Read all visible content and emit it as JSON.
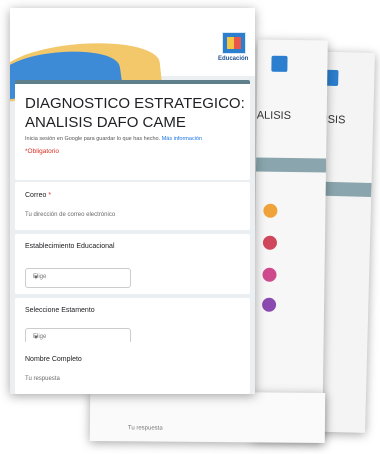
{
  "background_pages": {
    "title_peek": "ALISIS",
    "title_peek_far": "NALISIS",
    "peek_bottom_response": "Tu respuesta"
  },
  "form": {
    "title": "DIAGNOSTICO ESTRATEGICO: ANALISIS DAFO CAME",
    "signin_text": "Inicia sesión en Google para guardar lo que has hecho.",
    "signin_link": "Más información",
    "required_note": "*Obligatorio",
    "logo_text": "Educación",
    "questions": [
      {
        "label": "Correo",
        "required": true,
        "hint": "Tu dirección de correo electrónico"
      },
      {
        "label": "Establecimiento Educacional",
        "placeholder": "Elige"
      },
      {
        "label": "Seleccione Estamento",
        "placeholder": "Elige"
      },
      {
        "label": "Nombre Completo",
        "hint": "Tu respuesta"
      }
    ]
  },
  "colors": {
    "accent_band": "#5f7f8a",
    "required": "#d93025",
    "link": "#1a73e8"
  }
}
